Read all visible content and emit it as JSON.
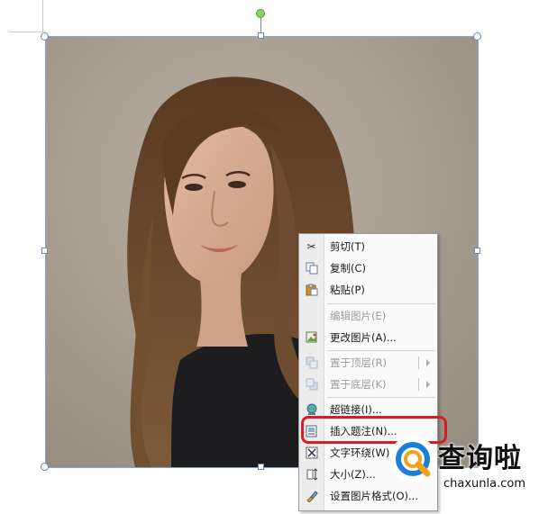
{
  "context_menu": {
    "items": [
      {
        "label": "剪切(T)",
        "icon": "scissors-icon",
        "disabled": false
      },
      {
        "label": "复制(C)",
        "icon": "copy-icon",
        "disabled": false
      },
      {
        "label": "粘贴(P)",
        "icon": "paste-icon",
        "disabled": false
      },
      {
        "label": "编辑图片(E)",
        "icon": "",
        "disabled": true
      },
      {
        "label": "更改图片(A)...",
        "icon": "change-picture-icon",
        "disabled": false
      },
      {
        "label": "置于顶层(R)",
        "icon": "bring-to-front-icon",
        "disabled": true,
        "submenu": true
      },
      {
        "label": "置于底层(K)",
        "icon": "send-to-back-icon",
        "disabled": true,
        "submenu": true
      },
      {
        "label": "超链接(I)...",
        "icon": "hyperlink-icon",
        "disabled": false
      },
      {
        "label": "插入题注(N)...",
        "icon": "insert-caption-icon",
        "disabled": false
      },
      {
        "label": "文字环绕(W)",
        "icon": "text-wrap-icon",
        "disabled": false,
        "submenu": true
      },
      {
        "label": "大小(Z)...",
        "icon": "size-icon",
        "disabled": false
      },
      {
        "label": "设置图片格式(O)...",
        "icon": "format-picture-icon",
        "disabled": false
      }
    ]
  },
  "highlighted_item": "插入题注(N)...",
  "colors": {
    "highlight_ring": "#d0202a",
    "watermark_blue": "#1a7fd6"
  },
  "watermark": {
    "brand": "查询啦",
    "url": "chaxunla.com"
  }
}
